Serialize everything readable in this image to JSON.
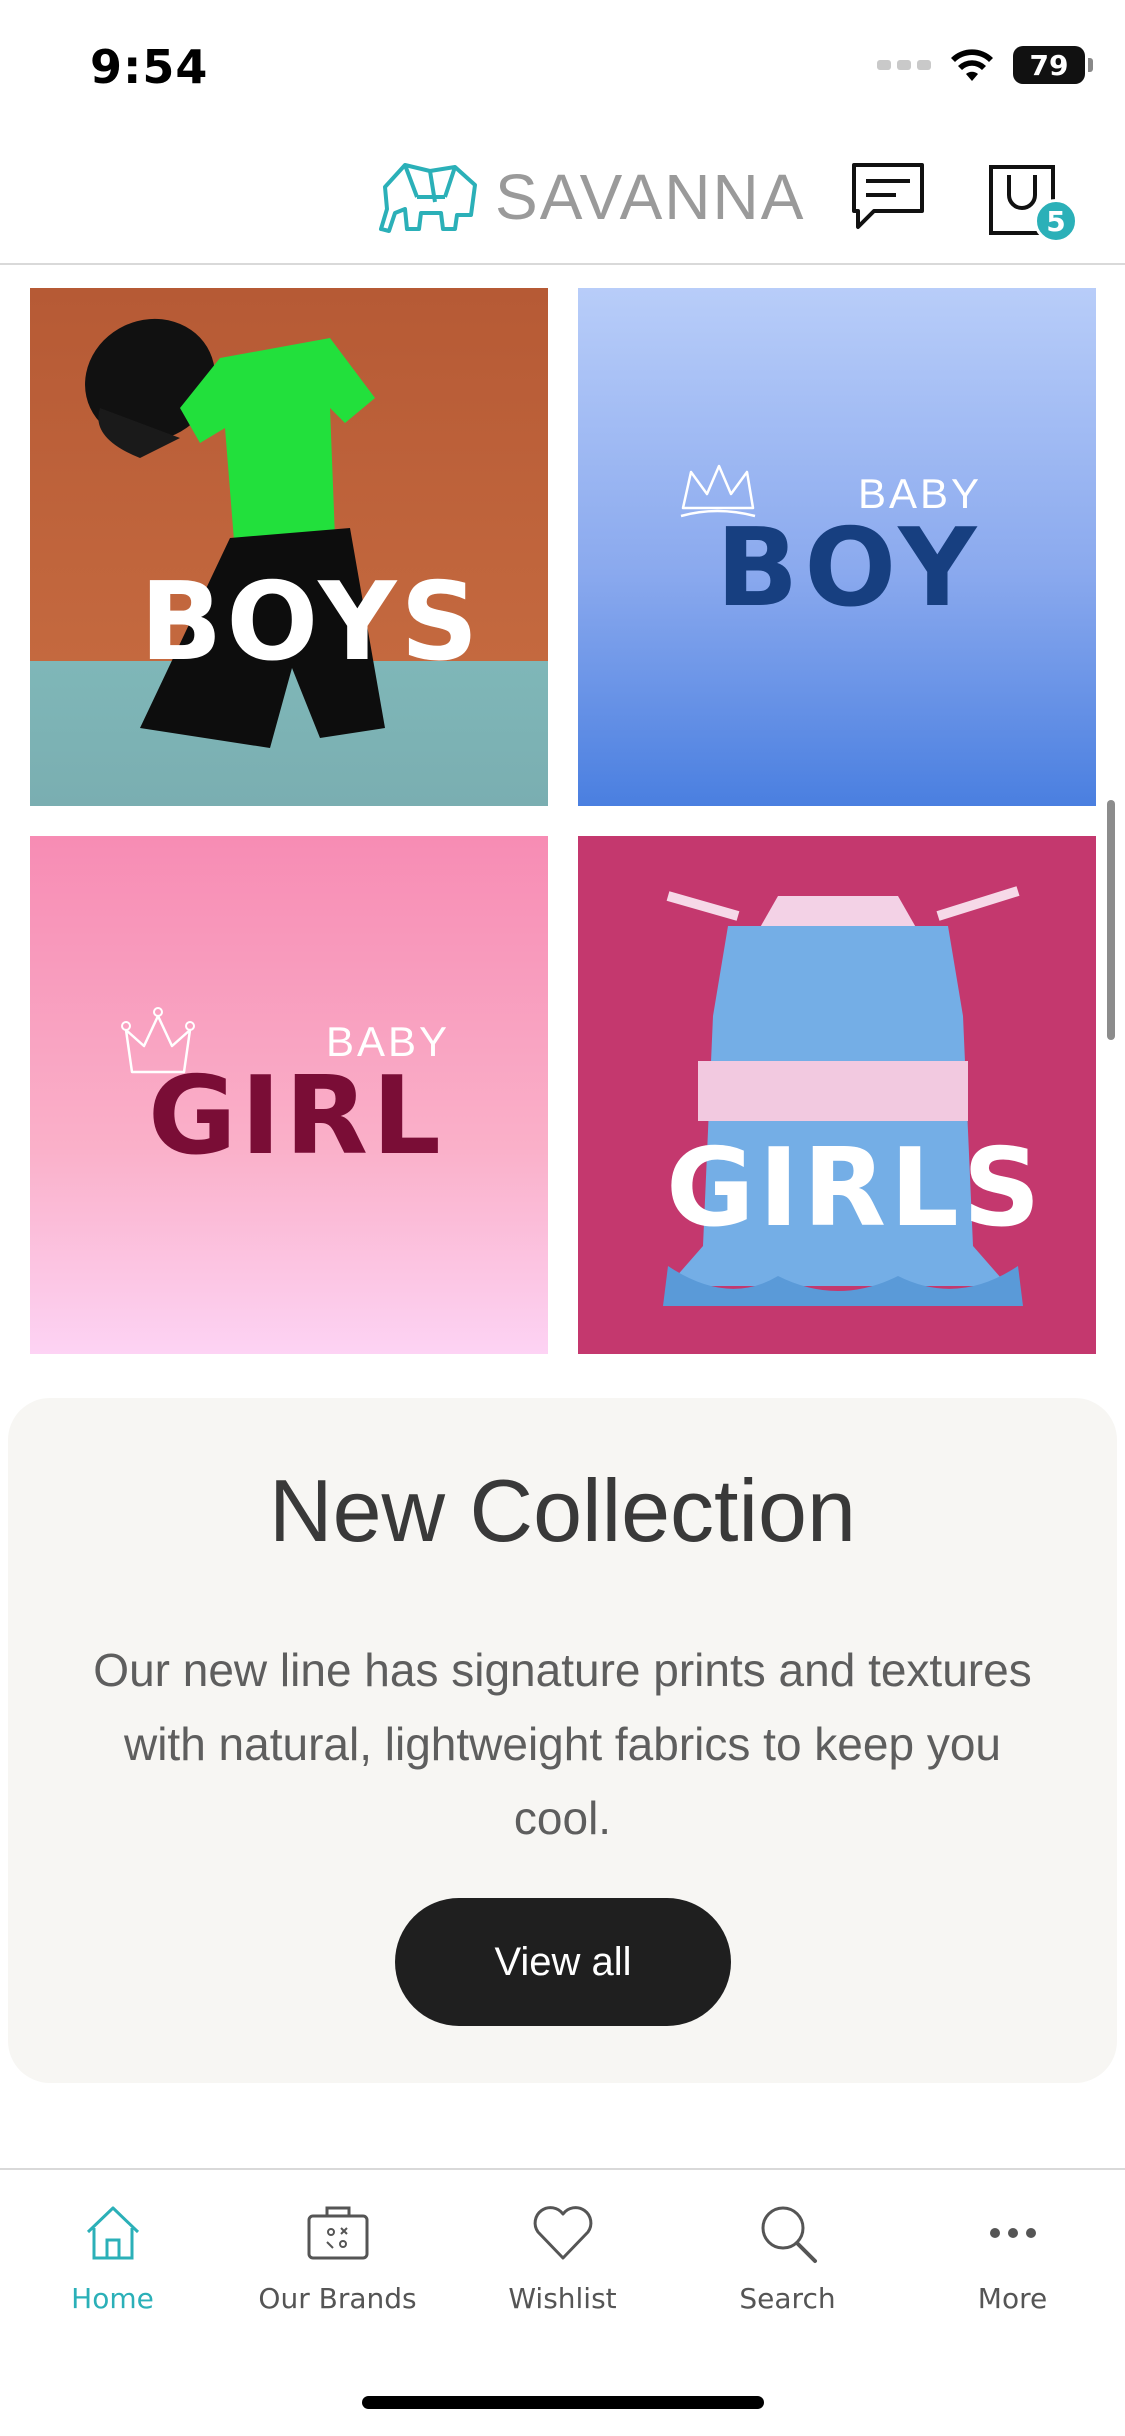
{
  "status_bar": {
    "time": "9:54",
    "battery": "79"
  },
  "header": {
    "brand_name": "SAVANNA",
    "cart_count": "5"
  },
  "categories": [
    {
      "label": "BOYS"
    },
    {
      "small": "BABY",
      "label": "BOY"
    },
    {
      "small": "BABY",
      "label": "GIRL"
    },
    {
      "label": "GIRLS"
    }
  ],
  "collection": {
    "title": "New Collection",
    "body": "Our new line has signature prints and textures with natural, lightweight fabrics to keep you cool.",
    "button": "View all"
  },
  "bottom_nav": [
    {
      "label": "Home",
      "icon": "home-icon",
      "active": true
    },
    {
      "label": "Our Brands",
      "icon": "brands-icon",
      "active": false
    },
    {
      "label": "Wishlist",
      "icon": "heart-icon",
      "active": false
    },
    {
      "label": "Search",
      "icon": "search-icon",
      "active": false
    },
    {
      "label": "More",
      "icon": "more-icon",
      "active": false
    }
  ],
  "colors": {
    "accent": "#2bb0b8",
    "button": "#1f1f1f",
    "panel": "#f7f6f3"
  }
}
